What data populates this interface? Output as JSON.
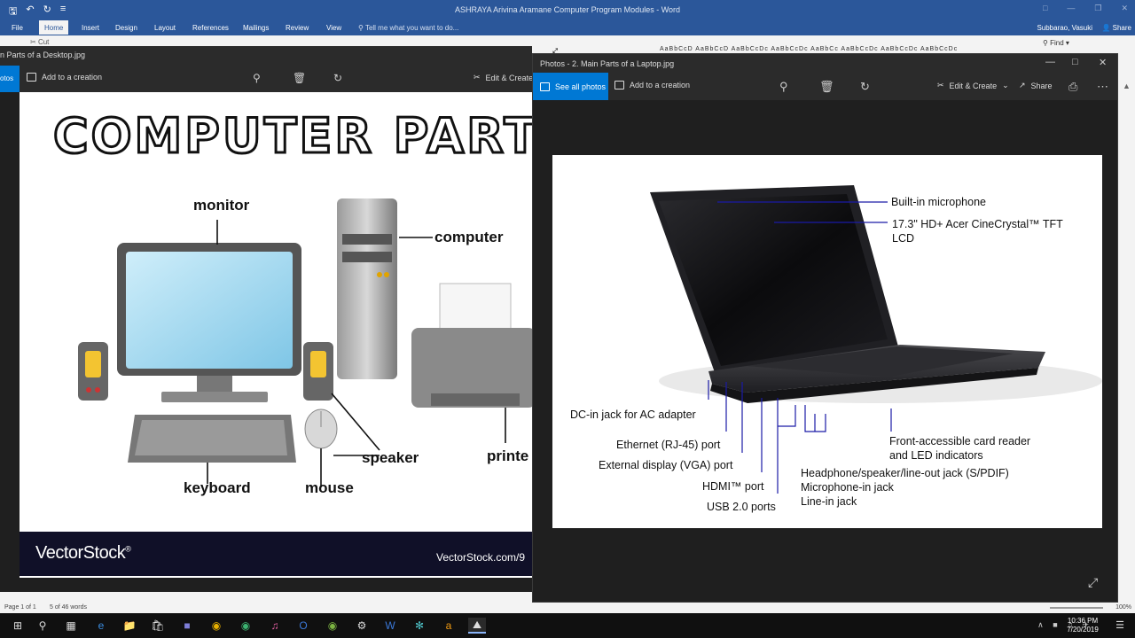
{
  "word": {
    "title": "ASHRAYA Arivina Aramane Computer Program Modules - Word",
    "tabs": [
      "File",
      "Home",
      "Insert",
      "Design",
      "Layout",
      "References",
      "Mailings",
      "Review",
      "View"
    ],
    "tell_me": "Tell me what you want to do...",
    "user": "Subbarao, Vasuki",
    "share": "Share",
    "cut": "Cut",
    "styles_preview": "AaBbCcD  AaBbCcD  AaBbCcDc  AaBbCcDc  AaBbCc  AaBbCcDc  AaBbCcDc  AaBbCcDc",
    "find": "Find",
    "status_page": "Page 1 of 1",
    "status_words": "5 of 46 words",
    "zoom": "100%"
  },
  "photos1": {
    "title": "n Parts of a Desktop.jpg",
    "see_all": "otos",
    "add_to_creation": "Add to a creation",
    "edit_create": "Edit & Create",
    "poster": {
      "title": "COMPUTER PARTS",
      "labels": {
        "monitor": "monitor",
        "computer": "computer",
        "speaker": "speaker",
        "printer": "printe",
        "keyboard": "keyboard",
        "mouse": "mouse"
      },
      "brand": "VectorStock",
      "brand_mark": "®",
      "url": "VectorStock.com/9"
    }
  },
  "photos2": {
    "title": "Photos - 2. Main Parts of a Laptop.jpg",
    "see_all": "See all photos",
    "add_to_creation": "Add to a creation",
    "edit_create": "Edit & Create",
    "share": "Share",
    "captions": {
      "microphone": "Built-in microphone",
      "lcd_line1": "17.3\" HD+ Acer CineCrystal™ TFT",
      "lcd_line2": "LCD",
      "dc_in": "DC-in jack for AC adapter",
      "ethernet": "Ethernet (RJ-45) port",
      "vga": "External display (VGA) port",
      "hdmi": "HDMI™ port",
      "usb": "USB 2.0 ports",
      "card_line1": "Front-accessible card reader",
      "card_line2": "and LED indicators",
      "headphone": "Headphone/speaker/line-out jack (S/PDIF)",
      "mic_in": "Microphone-in jack",
      "line_in": "Line-in jack"
    }
  },
  "taskbar": {
    "time": "10:36 PM",
    "date": "7/20/2019"
  },
  "colors": {
    "word_blue": "#2b579a",
    "photos_accent": "#0078d4",
    "callout_blue": "#1a1aa6"
  }
}
